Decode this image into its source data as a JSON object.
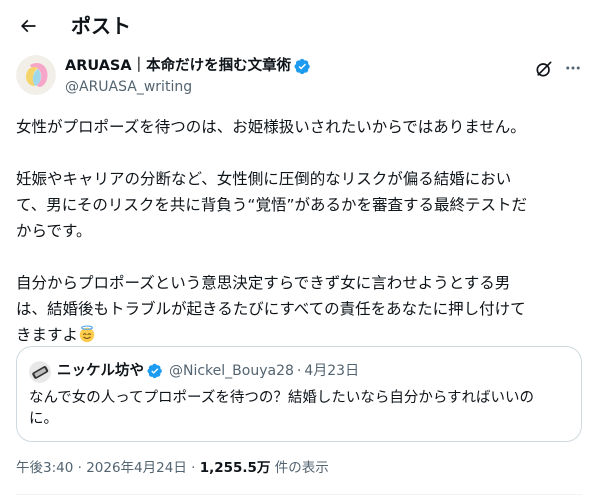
{
  "header": {
    "title": "ポスト"
  },
  "author": {
    "display_name": "ARUASA｜本命だけを掴む文章術",
    "handle": "@ARUASA_writing"
  },
  "tweet": {
    "lines": [
      "女性がプロポーズを待つのは、お姫様扱いされたいからではありません。",
      "",
      "妊娠やキャリアの分断など、女性側に圧倒的なリスクが偏る結婚におい",
      "て、男にそのリスクを共に背負う“覚悟”があるかを審査する最終テストだ",
      "からです。",
      "",
      "自分からプロポーズという意思決定すらできず女に言わせようとする男",
      "は、結婚後もトラブルが起きるたびにすべての責任をあなたに押し付けて",
      "きますよ"
    ],
    "emoji": "smiling-face-with-halo"
  },
  "quote": {
    "display_name": "ニッケル坊や",
    "handle": "@Nickel_Bouya28",
    "dot": "·",
    "date": "4月23日",
    "lines": [
      "なんで女の人ってプロポーズを待つの？結婚したいなら自分からすればいいの",
      "に。"
    ]
  },
  "meta": {
    "time": "午後3:40",
    "sep": " · ",
    "date": "2026年4月24日",
    "sep2": " · ",
    "views": "1,255.5万",
    "views_label": " 件の表示"
  },
  "colors": {
    "text": "#0f1419",
    "secondary": "#536471",
    "verified": "#1d9bf0",
    "border": "#cfd9de"
  }
}
